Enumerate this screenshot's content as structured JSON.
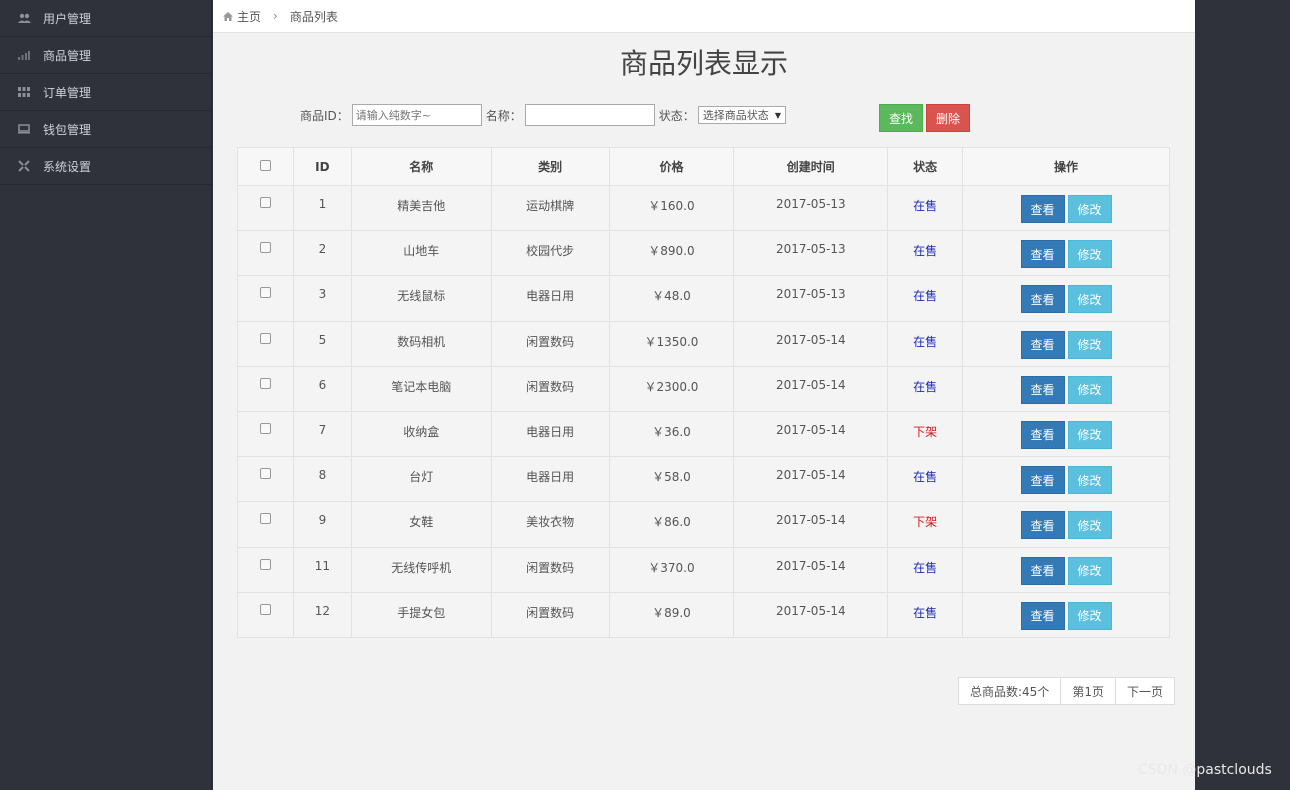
{
  "sidebar": {
    "items": [
      {
        "label": "用户管理",
        "icon": "users-icon"
      },
      {
        "label": "商品管理",
        "icon": "bar-chart-icon"
      },
      {
        "label": "订单管理",
        "icon": "grid-icon"
      },
      {
        "label": "钱包管理",
        "icon": "monitor-icon"
      },
      {
        "label": "系统设置",
        "icon": "settings-icon"
      }
    ]
  },
  "breadcrumb": {
    "home": "主页",
    "current": "商品列表"
  },
  "page_title": "商品列表显示",
  "search": {
    "id_label": "商品ID：",
    "id_placeholder": "请输入纯数字~",
    "name_label": "名称：",
    "name_value": "",
    "status_label": "状态：",
    "status_selected": "选择商品状态",
    "find_label": "查找",
    "delete_label": "删除"
  },
  "table": {
    "headers": [
      "",
      "ID",
      "名称",
      "类别",
      "价格",
      "创建时间",
      "状态",
      "操作"
    ],
    "rows": [
      {
        "id": "1",
        "name": "精美吉他",
        "category": "运动棋牌",
        "price": "￥160.0",
        "created": "2017-05-13",
        "status": "在售",
        "on": true
      },
      {
        "id": "2",
        "name": "山地车",
        "category": "校园代步",
        "price": "￥890.0",
        "created": "2017-05-13",
        "status": "在售",
        "on": true
      },
      {
        "id": "3",
        "name": "无线鼠标",
        "category": "电器日用",
        "price": "￥48.0",
        "created": "2017-05-13",
        "status": "在售",
        "on": true
      },
      {
        "id": "5",
        "name": "数码相机",
        "category": "闲置数码",
        "price": "￥1350.0",
        "created": "2017-05-14",
        "status": "在售",
        "on": true
      },
      {
        "id": "6",
        "name": "笔记本电脑",
        "category": "闲置数码",
        "price": "￥2300.0",
        "created": "2017-05-14",
        "status": "在售",
        "on": true
      },
      {
        "id": "7",
        "name": "收纳盒",
        "category": "电器日用",
        "price": "￥36.0",
        "created": "2017-05-14",
        "status": "下架",
        "on": false
      },
      {
        "id": "8",
        "name": "台灯",
        "category": "电器日用",
        "price": "￥58.0",
        "created": "2017-05-14",
        "status": "在售",
        "on": true
      },
      {
        "id": "9",
        "name": "女鞋",
        "category": "美妆衣物",
        "price": "￥86.0",
        "created": "2017-05-14",
        "status": "下架",
        "on": false
      },
      {
        "id": "11",
        "name": "无线传呼机",
        "category": "闲置数码",
        "price": "￥370.0",
        "created": "2017-05-14",
        "status": "在售",
        "on": true
      },
      {
        "id": "12",
        "name": "手提女包",
        "category": "闲置数码",
        "price": "￥89.0",
        "created": "2017-05-14",
        "status": "在售",
        "on": true
      }
    ],
    "view_label": "查看",
    "edit_label": "修改"
  },
  "pager": {
    "total": "总商品数:45个",
    "page": "第1页",
    "next": "下一页"
  },
  "watermark": "CSDN @pastclouds",
  "colors": {
    "on": "#1a2bb3",
    "off": "#d21b1b",
    "view": "#337ab7",
    "edit": "#5bc0de",
    "find": "#5cb85c",
    "delete": "#d9534f"
  }
}
